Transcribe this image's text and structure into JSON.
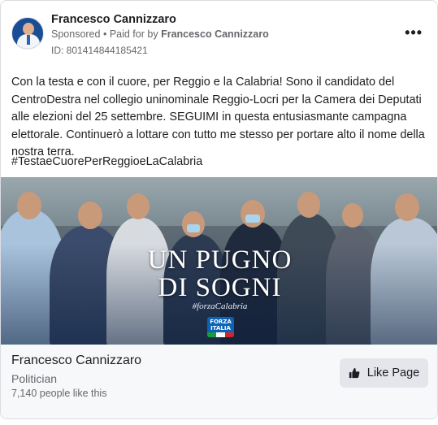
{
  "post": {
    "author": "Francesco Cannizzaro",
    "sponsored_label": "Sponsored",
    "paid_for_prefix": "Paid for by",
    "paid_for_name": "Francesco Cannizzaro",
    "ad_id": "ID: 801414844185421",
    "more_icon": "more-options-icon",
    "text": "Con la testa e con il cuore, per Reggio e la Calabria! Sono il candidato del CentroDestra nel collegio uninominale Reggio-Locri per la Camera dei Deputati alle elezioni del 25 settembre. SEGUIMI in questa entusiasmante campagna elettorale. Continuerò a lottare con tutto me stesso per portare alto il nome della nostra terra.",
    "hashtag": "#TestaeCuorePerReggioeLaCalabria"
  },
  "image": {
    "slogan_line1": "UN PUGNO",
    "slogan_line2": "DI SOGNI",
    "tag": "#forzaCalabria",
    "logo_text_1": "FORZA",
    "logo_text_2": "ITALIA"
  },
  "footer": {
    "page_name": "Francesco Cannizzaro",
    "category": "Politician",
    "likes": "7,140 people like this",
    "like_button": "Like Page",
    "like_icon": "thumbs-up-icon"
  },
  "colors": {
    "secondary_text": "#65676b",
    "button_bg": "#e4e6eb",
    "footer_bg": "#f7f8fa"
  }
}
